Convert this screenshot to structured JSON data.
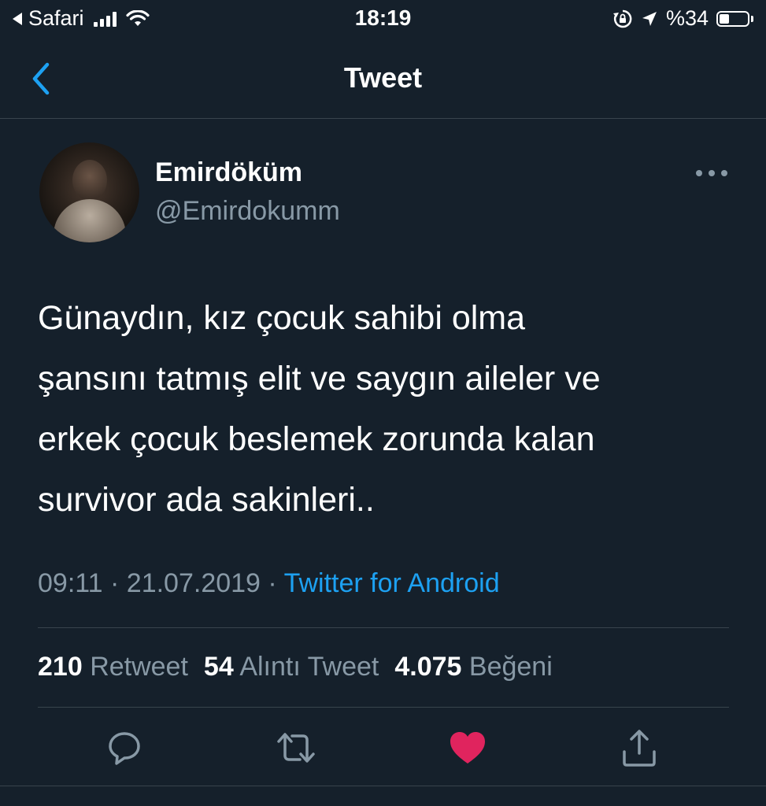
{
  "status_bar": {
    "back_app": "Safari",
    "time": "18:19",
    "battery": "%34",
    "battery_level": 0.34
  },
  "nav": {
    "title": "Tweet"
  },
  "tweet": {
    "author_name": "Emirdöküm",
    "author_handle": "@Emirdokumm",
    "text": "Günaydın, kız çocuk sahibi olma\nşansını tatmış elit ve saygın aileler ve\nerkek çocuk beslemek zorunda kalan\nsurvivor ada sakinleri..",
    "time": "09:11",
    "date": "21.07.2019",
    "separator": "·",
    "source": "Twitter for Android"
  },
  "stats": {
    "retweets_count": "210",
    "retweets_label": "Retweet",
    "quotes_count": "54",
    "quotes_label": "Alıntı Tweet",
    "likes_count": "4.075",
    "likes_label": "Beğeni"
  },
  "actions": {
    "reply_icon": "reply-icon",
    "retweet_icon": "retweet-icon",
    "like_icon": "heart-icon",
    "share_icon": "share-icon"
  },
  "colors": {
    "background": "#15202b",
    "accent": "#1da1f2",
    "secondary_text": "#8899a6",
    "like": "#e0245e",
    "divider": "#38444d"
  }
}
